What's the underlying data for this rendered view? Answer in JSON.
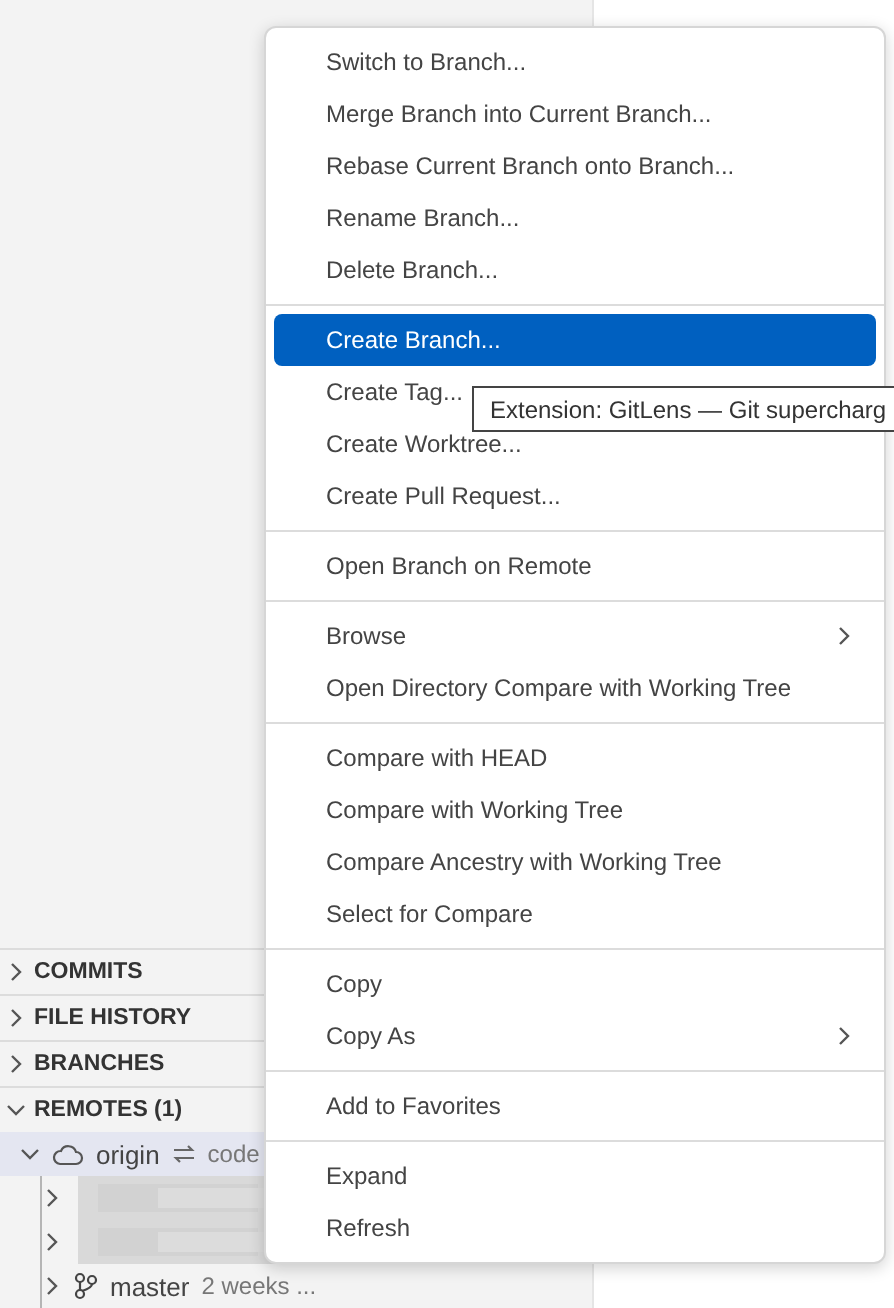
{
  "sidebar": {
    "sections": [
      {
        "label": "COMMITS",
        "expanded": false
      },
      {
        "label": "FILE HISTORY",
        "expanded": false
      },
      {
        "label": "BRANCHES",
        "expanded": false
      },
      {
        "label": "REMOTES (1)",
        "expanded": true
      }
    ],
    "remote": {
      "name": "origin",
      "detail": "code",
      "expanded": true,
      "selected": true
    },
    "branches": [
      {
        "kind": "redacted",
        "expanded": false
      },
      {
        "kind": "redacted",
        "expanded": false
      },
      {
        "kind": "branch",
        "name": "master",
        "detail": "2 weeks ...",
        "expanded": false
      }
    ]
  },
  "context_menu": {
    "groups": [
      [
        {
          "label": "Switch to Branch...",
          "selected": false,
          "submenu": false
        },
        {
          "label": "Merge Branch into Current Branch...",
          "selected": false,
          "submenu": false
        },
        {
          "label": "Rebase Current Branch onto Branch...",
          "selected": false,
          "submenu": false
        },
        {
          "label": "Rename Branch...",
          "selected": false,
          "submenu": false
        },
        {
          "label": "Delete Branch...",
          "selected": false,
          "submenu": false
        }
      ],
      [
        {
          "label": "Create Branch...",
          "selected": true,
          "submenu": false
        },
        {
          "label": "Create Tag...",
          "selected": false,
          "submenu": false
        },
        {
          "label": "Create Worktree...",
          "selected": false,
          "submenu": false
        },
        {
          "label": "Create Pull Request...",
          "selected": false,
          "submenu": false
        }
      ],
      [
        {
          "label": "Open Branch on Remote",
          "selected": false,
          "submenu": false
        }
      ],
      [
        {
          "label": "Browse",
          "selected": false,
          "submenu": true
        },
        {
          "label": "Open Directory Compare with Working Tree",
          "selected": false,
          "submenu": false
        }
      ],
      [
        {
          "label": "Compare with HEAD",
          "selected": false,
          "submenu": false
        },
        {
          "label": "Compare with Working Tree",
          "selected": false,
          "submenu": false
        },
        {
          "label": "Compare Ancestry with Working Tree",
          "selected": false,
          "submenu": false
        },
        {
          "label": "Select for Compare",
          "selected": false,
          "submenu": false
        }
      ],
      [
        {
          "label": "Copy",
          "selected": false,
          "submenu": false
        },
        {
          "label": "Copy As",
          "selected": false,
          "submenu": true
        }
      ],
      [
        {
          "label": "Add to Favorites",
          "selected": false,
          "submenu": false
        }
      ],
      [
        {
          "label": "Expand",
          "selected": false,
          "submenu": false
        },
        {
          "label": "Refresh",
          "selected": false,
          "submenu": false
        }
      ]
    ]
  },
  "tooltip": {
    "text": "Extension: GitLens — Git supercharg"
  }
}
